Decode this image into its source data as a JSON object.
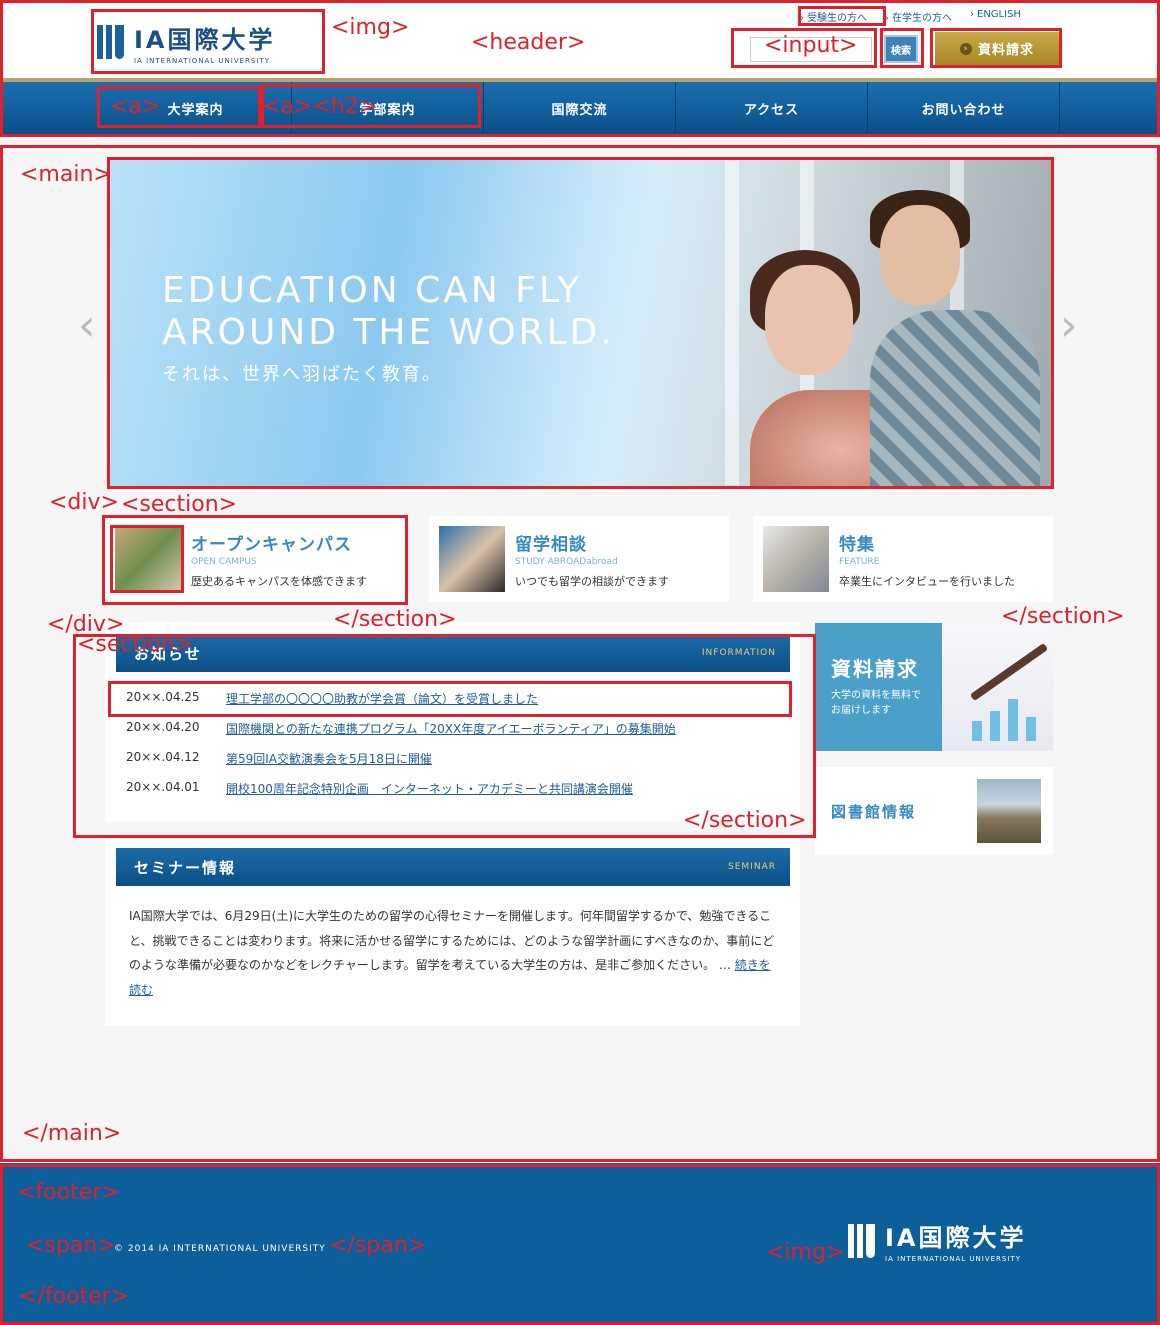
{
  "header": {
    "logo": {
      "jp": "IA国際大学",
      "en": "IA INTERNATIONAL UNIVERSITY"
    },
    "top_links": [
      "受験生の方へ",
      "在学生の方へ",
      "ENGLISH"
    ],
    "search_button": "検索",
    "request_button": "資料請求",
    "nav": [
      "大学案内",
      "学部案内",
      "国際交流",
      "アクセス",
      "お問い合わせ"
    ]
  },
  "hero": {
    "line1": "EDUCATION CAN FLY",
    "line2": "AROUND THE WORLD.",
    "sub": "それは、世界へ羽ばたく教育。",
    "prev": "‹",
    "next": "›"
  },
  "cards": [
    {
      "title": "オープンキャンパス",
      "en": "OPEN CAMPUS",
      "desc": "歴史あるキャンパスを体感できます"
    },
    {
      "title": "留学相談",
      "en": "STUDY ABROADabroad",
      "desc": "いつでも留学の相談ができます"
    },
    {
      "title": "特集",
      "en": "FEATURE",
      "desc": "卒業生にインタビューを行いました"
    }
  ],
  "news": {
    "title": "お知らせ",
    "en": "INFORMATION",
    "items": [
      {
        "date": "20××.04.25",
        "text": "理工学部の〇〇〇〇助教が学会賞（論文）を受賞しました"
      },
      {
        "date": "20××.04.20",
        "text": "国際機関との新たな連携プログラム「20XX年度アイエーボランティア」の募集開始"
      },
      {
        "date": "20××.04.12",
        "text": "第59回IA交歓演奏会を5月18日に開催"
      },
      {
        "date": "20××.04.01",
        "text": "開校100周年記念特別企画　インターネット・アカデミーと共同講演会開催"
      }
    ]
  },
  "seminar": {
    "title": "セミナー情報",
    "en": "SEMINAR",
    "body": "IA国際大学では、6月29日(土)に大学生のための留学の心得セミナーを開催します。何年間留学するかで、勉強できること、挑戦できることは変わります。将来に活かせる留学にするためには、どのような留学計画にすべきなのか、事前にどのような準備が必要なのかなどをレクチャーします。留学を考えている大学生の方は、是非ご参加ください。 …",
    "more": "続きを読む"
  },
  "side": {
    "request_title": "資料請求",
    "request_sub": "大学の資料を無料でお届けします",
    "library": "図書館情報"
  },
  "footer": {
    "copyright": "© 2014 IA INTERNATIONAL UNIVERSITY"
  },
  "annotations": {
    "img": "<img>",
    "header": "<header>",
    "input": "<input>",
    "a": "<a>",
    "a_h2": "<a><h2>",
    "main": "<main>",
    "main_end": "</main>",
    "div": "<div>",
    "section": "<section>",
    "div_end": "</div>",
    "section_end": "</section>",
    "section2": "<section>",
    "section_end2": "</section>",
    "section_end3": "</section>",
    "footer": "<footer>",
    "span": "<span>",
    "span_end": "</span>",
    "img2": "<img>",
    "footer_end": "</footer>"
  },
  "colors": {
    "brand": "#0d5f9b",
    "accent": "#e0202a",
    "gold": "#b6a46a"
  }
}
